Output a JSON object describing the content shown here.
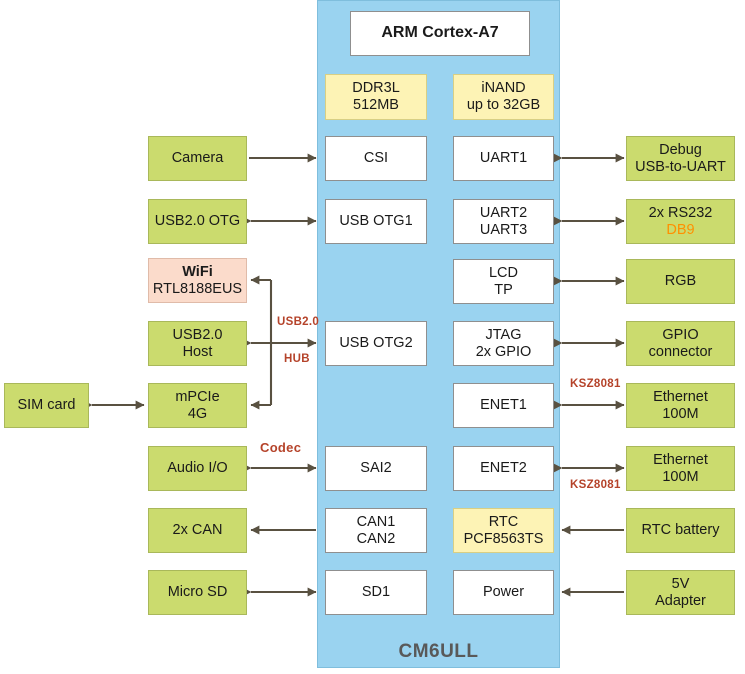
{
  "diagram": {
    "soc_label": "CM6ULL",
    "core": {
      "label": "ARM Cortex-A7"
    },
    "colors": {
      "soc_panel": "#9ad3f0",
      "peripheral_block": "#ffffff",
      "external_block": "#cbdb6e",
      "memory_block": "#fdf3b5",
      "wifi_block": "#fbdbcb",
      "arrow": "#595141",
      "bus_label": "#b5432a",
      "accent_orange": "#ff9000",
      "soc_title_text": "#595959"
    },
    "memory": [
      {
        "name": "ddr",
        "line1": "DDR3L",
        "line2": "512MB"
      },
      {
        "name": "inand",
        "line1": "iNAND",
        "line2": "up to 32GB"
      }
    ],
    "soc_blocks_left": [
      {
        "name": "csi",
        "line1": "CSI",
        "line2": ""
      },
      {
        "name": "usb-otg1",
        "line1": "USB OTG1",
        "line2": ""
      },
      {
        "name": "usb-otg2",
        "line1": "USB OTG2",
        "line2": ""
      },
      {
        "name": "sai2",
        "line1": "SAI2",
        "line2": ""
      },
      {
        "name": "can",
        "line1": "CAN1",
        "line2": "CAN2"
      },
      {
        "name": "sd1",
        "line1": "SD1",
        "line2": ""
      }
    ],
    "soc_blocks_right": [
      {
        "name": "uart1",
        "line1": "UART1",
        "line2": ""
      },
      {
        "name": "uart2-uart3",
        "line1": "UART2",
        "line2": "UART3"
      },
      {
        "name": "lcd-tp",
        "line1": "LCD",
        "line2": "TP"
      },
      {
        "name": "jtag-gpio",
        "line1": "JTAG",
        "line2": "2x GPIO"
      },
      {
        "name": "enet1",
        "line1": "ENET1",
        "line2": ""
      },
      {
        "name": "enet2",
        "line1": "ENET2",
        "line2": ""
      },
      {
        "name": "rtc",
        "line1": "RTC",
        "line2": "PCF8563TS"
      },
      {
        "name": "power",
        "line1": "Power",
        "line2": ""
      }
    ],
    "external_left": [
      {
        "name": "camera",
        "line1": "Camera",
        "line2": ""
      },
      {
        "name": "usb20-otg",
        "line1": "USB2.0 OTG",
        "line2": ""
      },
      {
        "name": "wifi",
        "line1": "WiFi",
        "line2": "RTL8188EUS"
      },
      {
        "name": "usb20-host",
        "line1": "USB2.0",
        "line2": "Host"
      },
      {
        "name": "mpcie-4g",
        "line1": "mPCIe",
        "line2": "4G"
      },
      {
        "name": "audio-io",
        "line1": "Audio I/O",
        "line2": ""
      },
      {
        "name": "can-2x",
        "line1": "2x CAN",
        "line2": ""
      },
      {
        "name": "micro-sd",
        "line1": "Micro SD",
        "line2": ""
      }
    ],
    "external_far_left": [
      {
        "name": "sim-card",
        "line1": "SIM card",
        "line2": ""
      }
    ],
    "external_right": [
      {
        "name": "debug-usb-to-uart",
        "line1": "Debug",
        "line2": "USB-to-UART"
      },
      {
        "name": "rs232-db9",
        "line1": "2x RS232",
        "line2": "DB9"
      },
      {
        "name": "rgb",
        "line1": "RGB",
        "line2": ""
      },
      {
        "name": "gpio-connector",
        "line1": "GPIO",
        "line2": "connector"
      },
      {
        "name": "ethernet-100m-1",
        "line1": "Ethernet",
        "line2": "100M"
      },
      {
        "name": "ethernet-100m-2",
        "line1": "Ethernet",
        "line2": "100M"
      },
      {
        "name": "rtc-battery",
        "line1": "RTC battery",
        "line2": ""
      },
      {
        "name": "5v-adapter",
        "line1": "5V",
        "line2": "Adapter"
      }
    ],
    "bus_labels": [
      {
        "name": "usb20-bus-label",
        "text": "USB2.0"
      },
      {
        "name": "hub-bus-label",
        "text": "HUB"
      },
      {
        "name": "codec-bus-label",
        "text": "Codec"
      },
      {
        "name": "ksz8081-enet1-label",
        "text": "KSZ8081"
      },
      {
        "name": "ksz8081-enet2-label",
        "text": "KSZ8081"
      }
    ]
  }
}
